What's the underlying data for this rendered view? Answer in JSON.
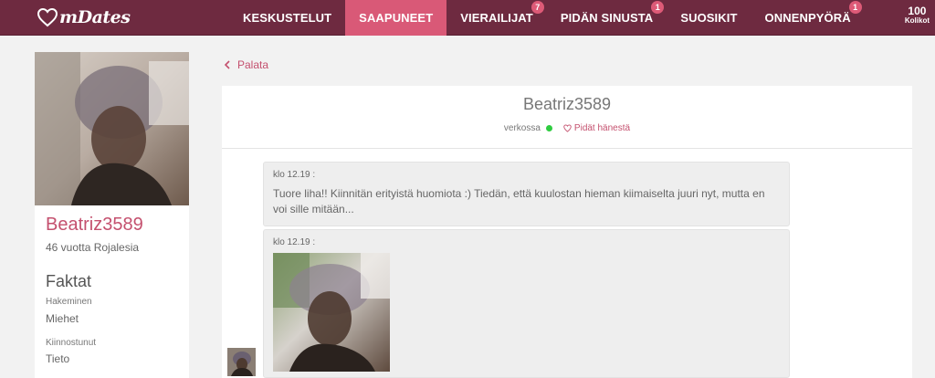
{
  "app": {
    "logo_letter": "m",
    "logo_text": "mDates",
    "brand_color": "#6e2a40",
    "accent_color": "#d95977"
  },
  "nav": {
    "items": [
      {
        "label": "KESKUSTELUT",
        "badge": ""
      },
      {
        "label": "SAAPUNEET",
        "badge": "",
        "active": true
      },
      {
        "label": "VIERAILIJAT",
        "badge": "7"
      },
      {
        "label": "PIDÄN SINUSTA",
        "badge": "1"
      },
      {
        "label": "SUOSIKIT",
        "badge": ""
      },
      {
        "label": "ONNENPYÖRÄ",
        "badge": "1"
      }
    ]
  },
  "coins": {
    "amount": "100",
    "label": "Kolikot"
  },
  "profile": {
    "photo_icon": "profile-photo",
    "username": "Beatriz3589",
    "age_location": "46 vuotta Rojalesia",
    "facts_title": "Faktat",
    "facts": [
      {
        "label": "Hakeminen",
        "value": "Miehet"
      },
      {
        "label": "Kiinnostunut",
        "value": "Tieto"
      }
    ]
  },
  "back_link": "Palata",
  "conversation": {
    "username": "Beatriz3589",
    "status": "verkossa",
    "status_color": "#2ecc40",
    "like_label": "Pidät hänestä",
    "messages": [
      {
        "time": "klo 12.19 :",
        "text": "Tuore liha!! Kiinnitän erityistä huomiota :) Tiedän, että kuulostan hieman kiimaiselta juuri nyt, mutta en voi sille mitään..."
      },
      {
        "time": "klo 12.19 :",
        "image_icon": "photo-attachment"
      }
    ]
  }
}
